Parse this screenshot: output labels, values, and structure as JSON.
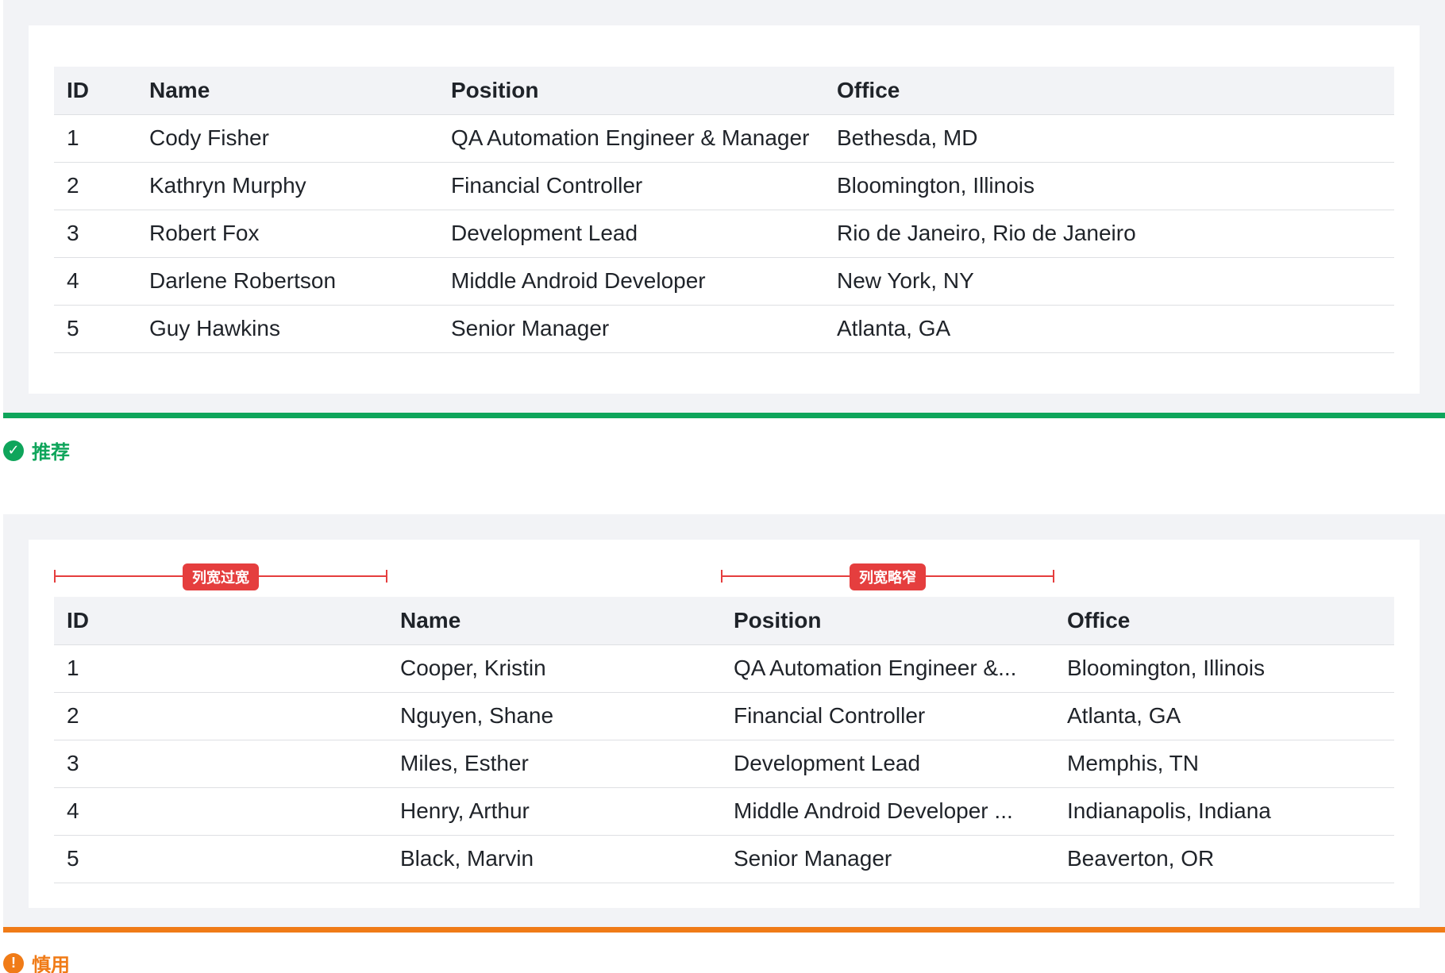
{
  "good_example": {
    "headers": [
      "ID",
      "Name",
      "Position",
      "Office"
    ],
    "rows": [
      [
        "1",
        "Cody Fisher",
        "QA Automation Engineer & Manager",
        "Bethesda, MD"
      ],
      [
        "2",
        "Kathryn Murphy",
        "Financial Controller",
        "Bloomington, Illinois"
      ],
      [
        "3",
        "Robert Fox",
        "Development Lead",
        "Rio de Janeiro, Rio de Janeiro"
      ],
      [
        "4",
        "Darlene Robertson",
        "Middle Android Developer",
        "New York, NY"
      ],
      [
        "5",
        "Guy Hawkins",
        "Senior Manager",
        "Atlanta, GA"
      ]
    ],
    "verdict_label": "推荐",
    "verdict_color": "#0fa55b"
  },
  "bad_example": {
    "annotations": {
      "too_wide": "列宽过宽",
      "too_narrow": "列宽略窄",
      "color": "#e53e3e"
    },
    "headers": [
      "ID",
      "Name",
      "Position",
      "Office"
    ],
    "rows": [
      [
        "1",
        "Cooper, Kristin",
        "QA Automation Engineer &...",
        "Bloomington, Illinois"
      ],
      [
        "2",
        "Nguyen, Shane",
        "Financial Controller",
        "Atlanta, GA"
      ],
      [
        "3",
        "Miles, Esther",
        "Development Lead",
        "Memphis, TN"
      ],
      [
        "4",
        "Henry, Arthur",
        "Middle Android Developer ...",
        "Indianapolis, Indiana"
      ],
      [
        "5",
        "Black, Marvin",
        "Senior Manager",
        "Beaverton, OR"
      ]
    ],
    "verdict_label": "慎用",
    "verdict_color": "#f07b17"
  },
  "icons": {
    "good": "check-circle-icon",
    "bad": "exclamation-circle-icon"
  }
}
